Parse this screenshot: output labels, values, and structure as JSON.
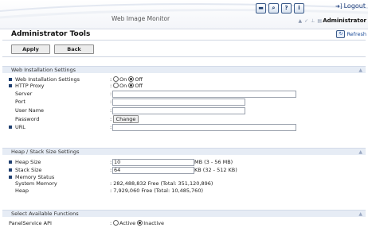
{
  "header": {
    "title": "Web Image Monitor",
    "logout_label": "Logout",
    "user_label": "Administrator",
    "icons": [
      "mail-icon",
      "search-icon",
      "help-icon",
      "info-icon"
    ]
  },
  "page": {
    "title": "Administrator Tools",
    "refresh_label": "Refresh",
    "apply_label": "Apply",
    "back_label": "Back"
  },
  "sections": {
    "web_install": {
      "title": "Web Installation Settings",
      "web_install_label": "Web Installation Settings",
      "on_label": "On",
      "off_label": "Off",
      "http_proxy_label": "HTTP Proxy",
      "server_label": "Server",
      "port_label": "Port",
      "username_label": "User Name",
      "password_label": "Password",
      "change_label": "Change",
      "url_label": "URL",
      "web_install_value": "Off",
      "http_proxy_value": "Off"
    },
    "heap": {
      "title": "Heap / Stack Size Settings",
      "heap_label": "Heap Size",
      "heap_value": "10",
      "heap_unit": "MB (3 - 56 MB)",
      "stack_label": "Stack Size",
      "stack_value": "64",
      "stack_unit": "KB (32 - 512 KB)",
      "memory_label": "Memory Status",
      "system_memory_label": "System Memory",
      "system_memory_value": ": 282,488,832 Free   (Total: 351,120,896)",
      "heap_mem_label": "Heap",
      "heap_mem_value": ":   7,929,060 Free   (Total: 10,485,760)"
    },
    "functions": {
      "title": "Select Available Functions",
      "panel_label": "PanelService API",
      "active_label": "Active",
      "inactive_label": "Inactive",
      "panel_value": "Inactive"
    }
  }
}
